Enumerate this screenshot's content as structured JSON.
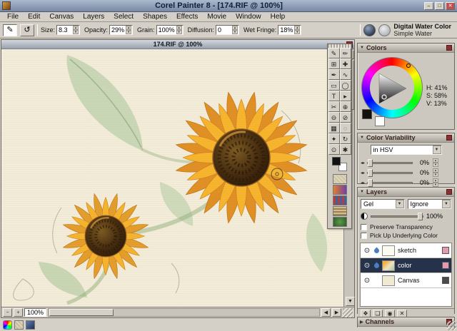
{
  "titlebar": {
    "title": "Corel Painter 8 - [174.RIF @ 100%]",
    "buttons": {
      "min": "‒",
      "max": "□",
      "close": "✕"
    }
  },
  "menubar": {
    "items": [
      "File",
      "Edit",
      "Canvas",
      "Layers",
      "Select",
      "Shapes",
      "Effects",
      "Movie",
      "Window",
      "Help"
    ]
  },
  "property_bar": {
    "brush_tool_glyph": "✎",
    "tracker_glyph": "↺",
    "fields": [
      {
        "label": "Size:",
        "value": "8.3"
      },
      {
        "label": "Opacity:",
        "value": "29%"
      },
      {
        "label": "Grain:",
        "value": "100%"
      },
      {
        "label": "Diffusion:",
        "value": "0"
      },
      {
        "label": "Wet Fringe:",
        "value": "18%"
      }
    ],
    "brush_category": "Digital Water Color",
    "brush_variant": "Simple Water"
  },
  "document": {
    "title": "174.RIF @ 100%",
    "zoom": "100%"
  },
  "toolbox": {
    "tools": [
      {
        "name": "brush-tool",
        "glyph": "✎"
      },
      {
        "name": "dropper-tool",
        "glyph": "✏"
      },
      {
        "name": "crop-tool",
        "glyph": "⊞"
      },
      {
        "name": "layer-adjuster-tool",
        "glyph": "✚"
      },
      {
        "name": "pen-tool",
        "glyph": "✒"
      },
      {
        "name": "quick-curve-tool",
        "glyph": "∿"
      },
      {
        "name": "rect-shape-tool",
        "glyph": "▭"
      },
      {
        "name": "oval-shape-tool",
        "glyph": "◯"
      },
      {
        "name": "text-tool",
        "glyph": "T"
      },
      {
        "name": "shape-selection-tool",
        "glyph": "▸"
      },
      {
        "name": "scissors-tool",
        "glyph": "✂"
      },
      {
        "name": "add-point-tool",
        "glyph": "⊕"
      },
      {
        "name": "remove-point-tool",
        "glyph": "⊖"
      },
      {
        "name": "convert-point-tool",
        "glyph": "⊘"
      },
      {
        "name": "rect-selection-tool",
        "glyph": "▦"
      },
      {
        "name": "lasso-tool",
        "glyph": "◌"
      },
      {
        "name": "magic-wand-tool",
        "glyph": "✦"
      },
      {
        "name": "rotate-page-tool",
        "glyph": "↻"
      },
      {
        "name": "magnifier-tool",
        "glyph": "⊙"
      },
      {
        "name": "grabber-tool",
        "glyph": "✱"
      }
    ]
  },
  "colors_panel": {
    "title": "Colors",
    "hsv": [
      "H: 41%",
      "S: 58%",
      "V: 13%"
    ]
  },
  "color_variability_panel": {
    "title": "Color Variability",
    "mode": "in HSV",
    "sliders": [
      {
        "value": "0%"
      },
      {
        "value": "0%"
      },
      {
        "value": "0%"
      }
    ]
  },
  "layers_panel": {
    "title": "Layers",
    "composite_method": "Gel",
    "composite_depth": "Ignore",
    "opacity": "100%",
    "eye_glyph": "⊙",
    "checkboxes": [
      {
        "label": "Preserve Transparency"
      },
      {
        "label": "Pick Up Underlying Color"
      }
    ],
    "layers": [
      {
        "name": "sketch",
        "state": "normal",
        "type": "wc",
        "thumb_css": "background:#fcf9f0",
        "badge_css": "background:#e09cae"
      },
      {
        "name": "color",
        "state": "selected",
        "type": "wc",
        "thumb_css": "background:linear-gradient(135deg,#f5b43a 20%,#ece2c6 55%,#a9c79b)",
        "badge_css": "background:#e09cae"
      },
      {
        "name": "Canvas",
        "state": "normal",
        "type": "canvas",
        "thumb_css": "background:#f0e9d4",
        "badge_css": "background:#4a4a4a"
      }
    ],
    "buttons": [
      {
        "name": "dynamic-plugins-button",
        "glyph": "❖"
      },
      {
        "name": "new-layer-button",
        "glyph": "❏"
      },
      {
        "name": "new-watercolor-layer-button",
        "glyph": "◉"
      },
      {
        "name": "delete-layer-button",
        "glyph": "✕"
      }
    ]
  },
  "channels_panel": {
    "title": "Channels"
  },
  "accent_colors": {
    "panel_close": "#8a3030",
    "selected_layer": "#26324a",
    "paper": "#f2ecd8"
  }
}
